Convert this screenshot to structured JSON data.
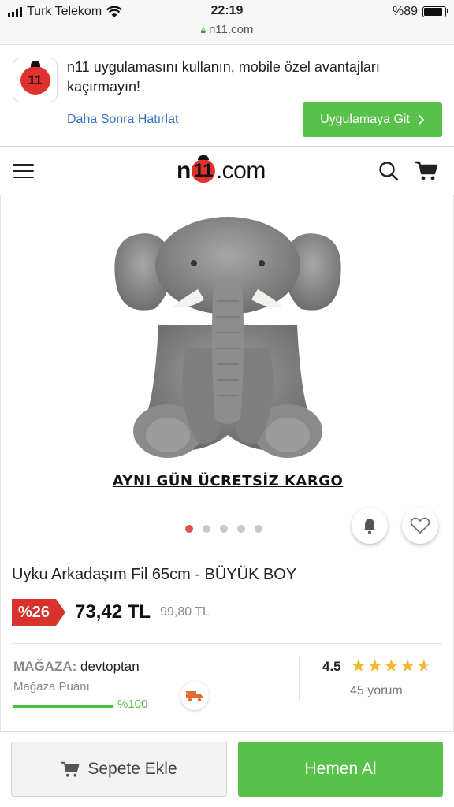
{
  "status_bar": {
    "carrier": "Turk Telekom",
    "time": "22:19",
    "battery": "%89",
    "battery_level": 0.89,
    "url": "n11.com"
  },
  "app_banner": {
    "logo_text": "11",
    "message": "n11 uygulamasını kullanın, mobile özel avantajları kaçırmayın!",
    "later_link": "Daha Sonra Hatırlat",
    "go_button": "Uygulamaya Git"
  },
  "header": {
    "logo_left": "n",
    "logo_mid": "11",
    "logo_right": ".com"
  },
  "product": {
    "image_caption": "AYNI GÜN ÜCRETSİZ KARGO",
    "carousel_total": 5,
    "carousel_active": 1,
    "title": "Uyku Arkadaşım Fil 65cm - BÜYÜK BOY",
    "discount": "%26",
    "price": "73,42 TL",
    "old_price": "99,80 TL"
  },
  "store": {
    "label": "MAĞAZA:",
    "name": "devtoptan",
    "score_label": "Mağaza Puanı",
    "score_percent": "%100",
    "score_level": 1.0
  },
  "rating": {
    "value": "4.5",
    "stars": 4.5,
    "reviews": "45 yorum"
  },
  "actions": {
    "add_to_cart": "Sepete Ekle",
    "buy_now": "Hemen Al"
  },
  "colors": {
    "brand_red": "#e0312f",
    "green": "#58c14a",
    "link_blue": "#3a72c4"
  }
}
